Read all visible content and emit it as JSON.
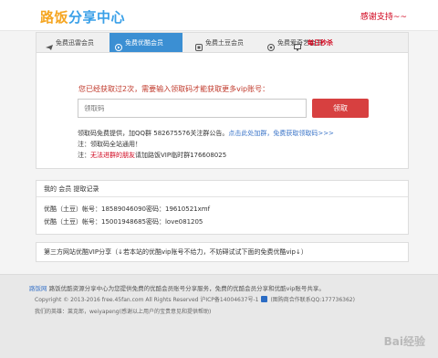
{
  "header": {
    "logo_part1": "路饭",
    "logo_part2": "分享中心",
    "thanks": "感谢支持~~"
  },
  "tabs": [
    {
      "label": "免费迅雷会员"
    },
    {
      "label": "免费优酷会员"
    },
    {
      "label": "免费土豆会员"
    },
    {
      "label": "免费爱奇艺会员"
    },
    {
      "label": "每日秒杀"
    }
  ],
  "main": {
    "notice": "您已经获取过2次，需要输入领取码才能获取更多vip账号：",
    "code_placeholder": "领取码",
    "get_button": "领取",
    "info_line1_prefix": "领取码免费提供，加QQ群 582675576关注群公告。",
    "info_line1_link": "点击此处加群，免费获取领取码>>>",
    "info_line2": "注：领取码全站通用！",
    "info_line3_prefix": "注：",
    "info_line3_red": "无法进群的朋友",
    "info_line3_suffix": "请加路饭VIP临时群176608025"
  },
  "records": {
    "title": "我的 会员 提取记录",
    "rows": [
      "优酷（土豆）帐号：18589046090密码：19610521xmf",
      "优酷（土豆）帐号：15001948685密码：love081205"
    ]
  },
  "third_party": {
    "title": "第三方网站优酷VIP分享（↓若本站的优酷vip账号不给力，不妨碍试试下面的免费优酷vip↓）"
  },
  "footer": {
    "brand": "路饭网",
    "desc": "路饭优酷资源分享中心为您提供免费的优酷会员账号分享服务，免费的优酷会员分享和优酷vip账号共享。",
    "copyright": "Copyright © 2013-2016 free.45fan.com All Rights Reserved 沪ICP备14004637号-1",
    "contact": "(图购商合作联系QQ:177736362)",
    "credits": "我们的英雄：莱克郎，weiyapeng(感谢以上用户的宝贵意见和提供帮助)",
    "watermark": "Bai经验"
  }
}
